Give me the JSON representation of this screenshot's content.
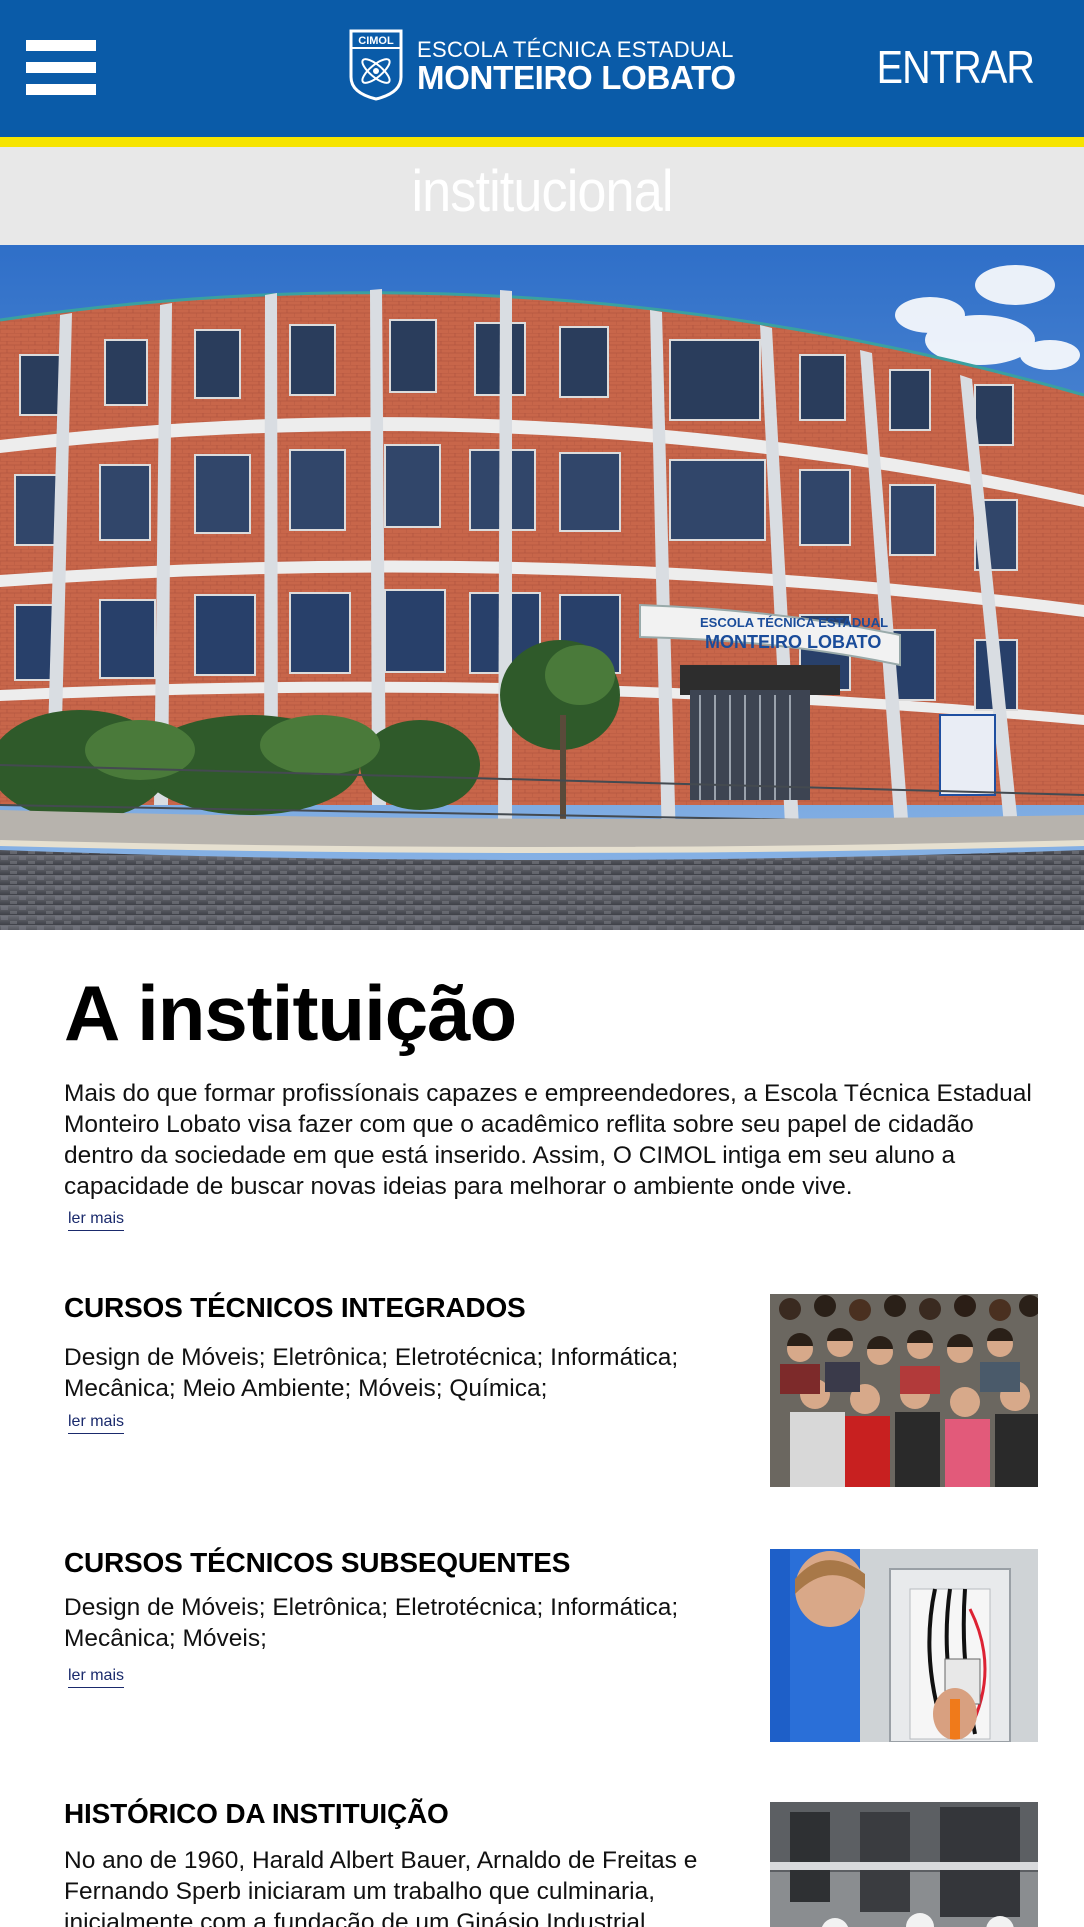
{
  "header": {
    "logo_line1": "ESCOLA TÉCNICA ESTADUAL",
    "logo_line2": "MONTEIRO LOBATO",
    "logo_badge": "CIMOL",
    "login_label": "ENTRAR",
    "menu_icon": "hamburger-menu-icon",
    "colors": {
      "header_bg": "#0a5ba8",
      "accent_stripe": "#f6e400"
    }
  },
  "section": {
    "title": "institucional"
  },
  "hero": {
    "sign_line1": "ESCOLA TÉCNICA ESTADUAL",
    "sign_line2": "MONTEIRO LOBATO"
  },
  "main": {
    "heading": "A instituição",
    "intro": "Mais do que formar profissíonais capazes e empreendedores, a Escola Técnica Estadual Monteiro Lobato visa fazer com que o acadêmico reflita sobre seu papel de cidadão dentro da sociedade em que está inserido. Assim, O CIMOL intiga em seu aluno a capacidade de buscar novas ideias para melhorar o ambiente onde vive.",
    "read_more": "ler mais"
  },
  "courses": [
    {
      "title": "CURSOS TÉCNICOS INTEGRADOS",
      "text": "Design de Móveis; Eletrônica; Eletrotécnica; Informática; Mecânica; Meio Ambiente; Móveis; Química;",
      "read_more": "ler mais"
    },
    {
      "title": "CURSOS TÉCNICOS SUBSEQUENTES",
      "text": "Design de Móveis; Eletrônica; Eletrotécnica; Informática; Mecânica; Móveis;",
      "read_more": "ler mais"
    },
    {
      "title": "HISTÓRICO DA INSTITUIÇÃO",
      "text": "No ano de 1960, Harald Albert Bauer, Arnaldo de Freitas e Fernando Sperb iniciaram um trabalho que culminaria, inicialmente com a fundação de um Ginásio Industrial"
    }
  ]
}
